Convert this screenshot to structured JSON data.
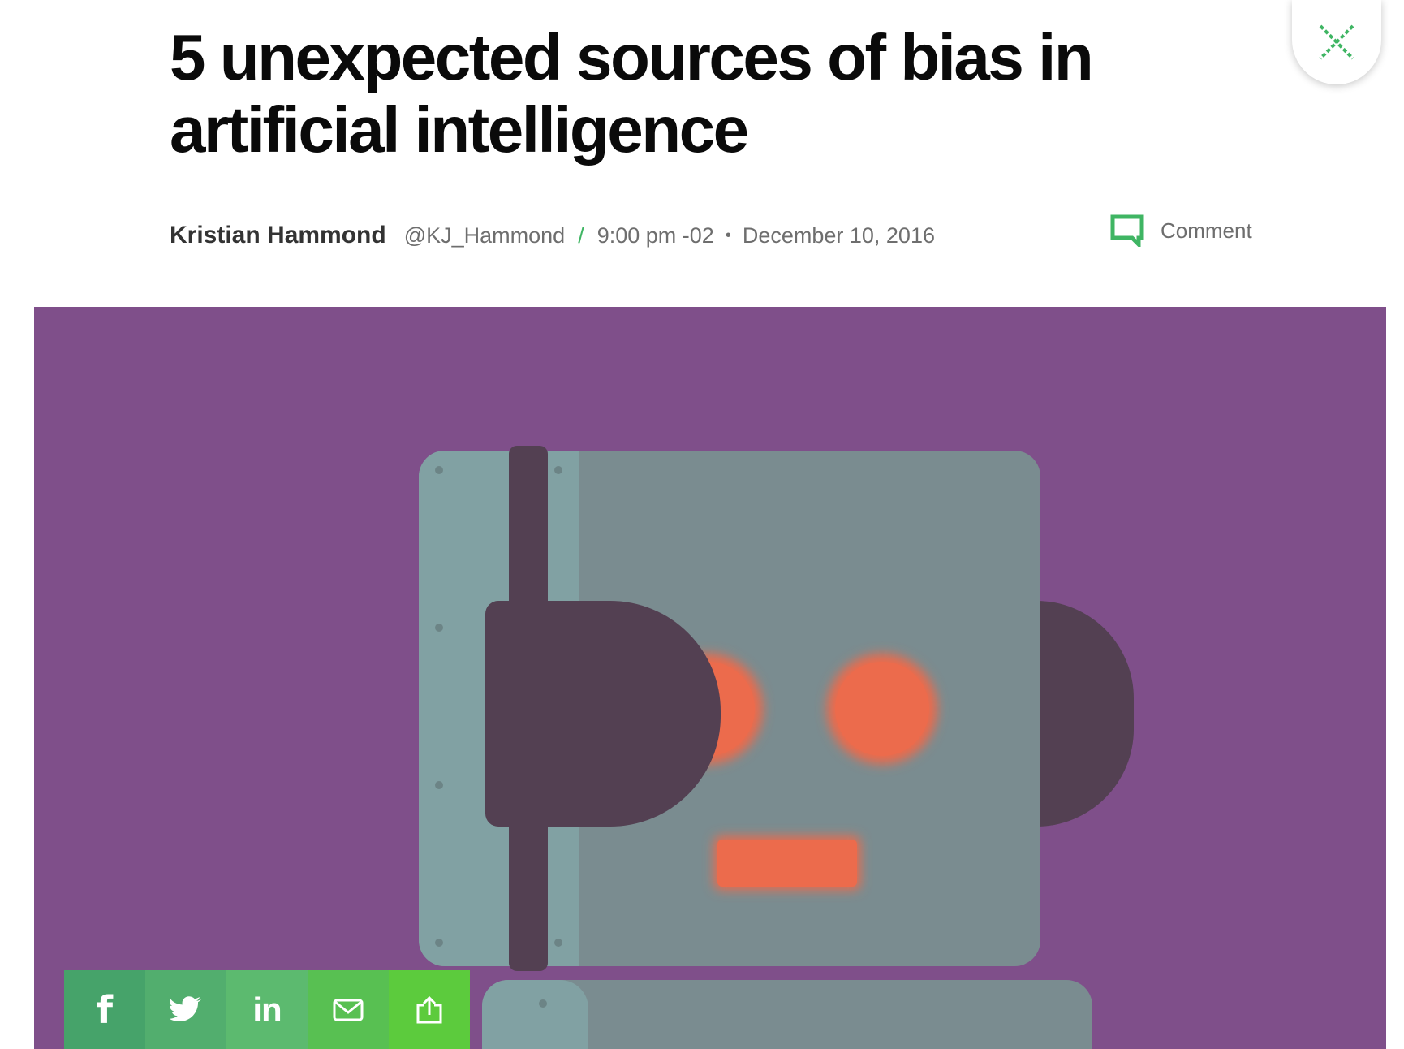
{
  "article": {
    "title": "5 unexpected sources of bias in artificial intelligence",
    "author": "Kristian Hammond",
    "handle": "@KJ_Hammond",
    "separator": "/",
    "time": "9:00 pm -02",
    "bullet": "•",
    "date": "December 10, 2016"
  },
  "comment": {
    "label": "Comment"
  },
  "share": {
    "buttons": [
      {
        "name": "facebook",
        "glyph": "f",
        "color": "#46a36a"
      },
      {
        "name": "twitter",
        "glyph": "twitter-bird",
        "color": "#52ae6e"
      },
      {
        "name": "linkedin",
        "glyph": "in",
        "color": "#5cba6f"
      },
      {
        "name": "email",
        "glyph": "envelope",
        "color": "#58c052"
      },
      {
        "name": "share",
        "glyph": "share-up",
        "color": "#5ccb3d"
      }
    ]
  },
  "colors": {
    "accent_green": "#3fb563",
    "hero_purple": "#7f4f8a",
    "robot_head": "#7a8c90",
    "robot_dark": "#534052",
    "robot_eye": "#ec6b4c"
  }
}
